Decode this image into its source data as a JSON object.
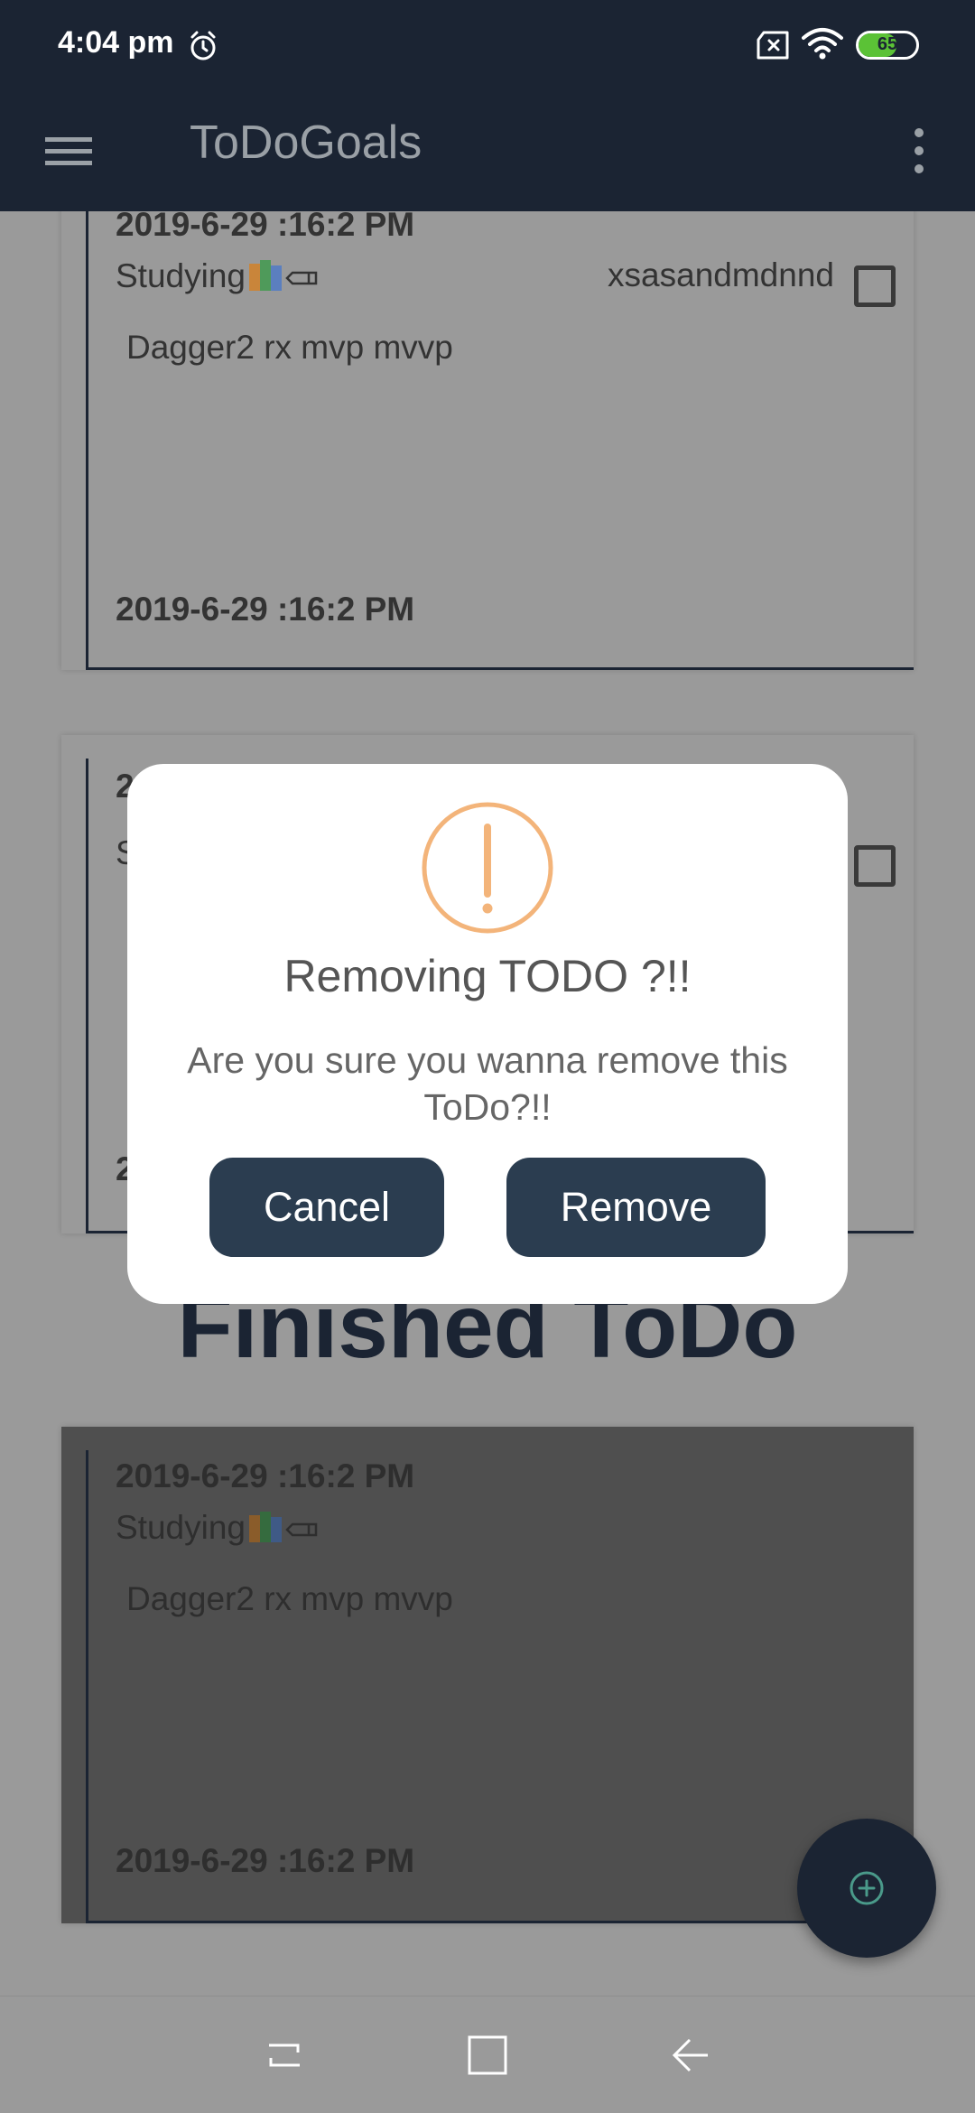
{
  "status_bar": {
    "time": "4:04 pm",
    "battery": "65",
    "battery_level": 0.65
  },
  "app_bar": {
    "title": "ToDoGoals",
    "menu_icon": "hamburger-menu-icon",
    "more_icon": "more-vert-icon"
  },
  "todo_cards": [
    {
      "date_top": "2019-6-29 :16:2 PM",
      "category": "Studying",
      "tag": "xsasandmdnnd",
      "description": "Dagger2 rx mvp mvvp",
      "date_bottom": "2019-6-29 :16:2 PM"
    },
    {
      "date_top": "2",
      "category": "S",
      "date_bottom": "2"
    }
  ],
  "finished_section": {
    "title": "Finished ToDo",
    "card": {
      "date_top": "2019-6-29 :16:2 PM",
      "category": "Studying",
      "description": "Dagger2 rx mvp mvvp",
      "date_bottom": "2019-6-29 :16:2 PM"
    }
  },
  "dialog": {
    "icon": "warning-icon",
    "title": "Removing TODO ?!!",
    "message": "Are you sure you wanna remove this ToDo?!!",
    "cancel_label": "Cancel",
    "remove_label": "Remove"
  },
  "colors": {
    "app_bar": "#1b2433",
    "button": "#2b3d50",
    "warning": "#f3b47a",
    "battery": "#5bc236"
  }
}
